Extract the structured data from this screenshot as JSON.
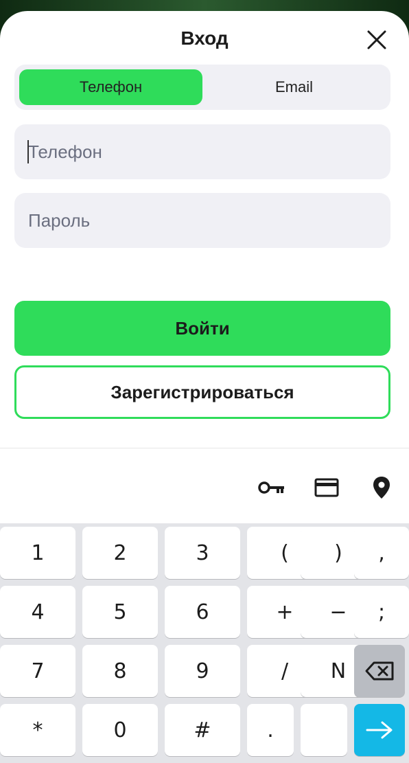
{
  "header": {
    "title": "Вход"
  },
  "tabs": [
    {
      "label": "Телефон",
      "active": true
    },
    {
      "label": "Email",
      "active": false
    }
  ],
  "form": {
    "phone_placeholder": "Телефон",
    "password_placeholder": "Пароль",
    "login_label": "Войти",
    "register_label": "Зарегистрироваться"
  },
  "keyboard_toolbar": {
    "icons": [
      "key-icon",
      "credit-card-icon",
      "location-pin-icon"
    ]
  },
  "keyboard": {
    "rows": [
      [
        "1",
        "2",
        "3",
        "(",
        ")",
        ","
      ],
      [
        "4",
        "5",
        "6",
        "+",
        "−",
        ";"
      ],
      [
        "7",
        "8",
        "9",
        "/",
        "N",
        "backspace"
      ],
      [
        "*",
        "0",
        "#",
        ".",
        "",
        "enter"
      ]
    ]
  },
  "colors": {
    "accent": "#2fdc5a",
    "field_bg": "#f0f0f5",
    "enter_key": "#14b8e6"
  }
}
